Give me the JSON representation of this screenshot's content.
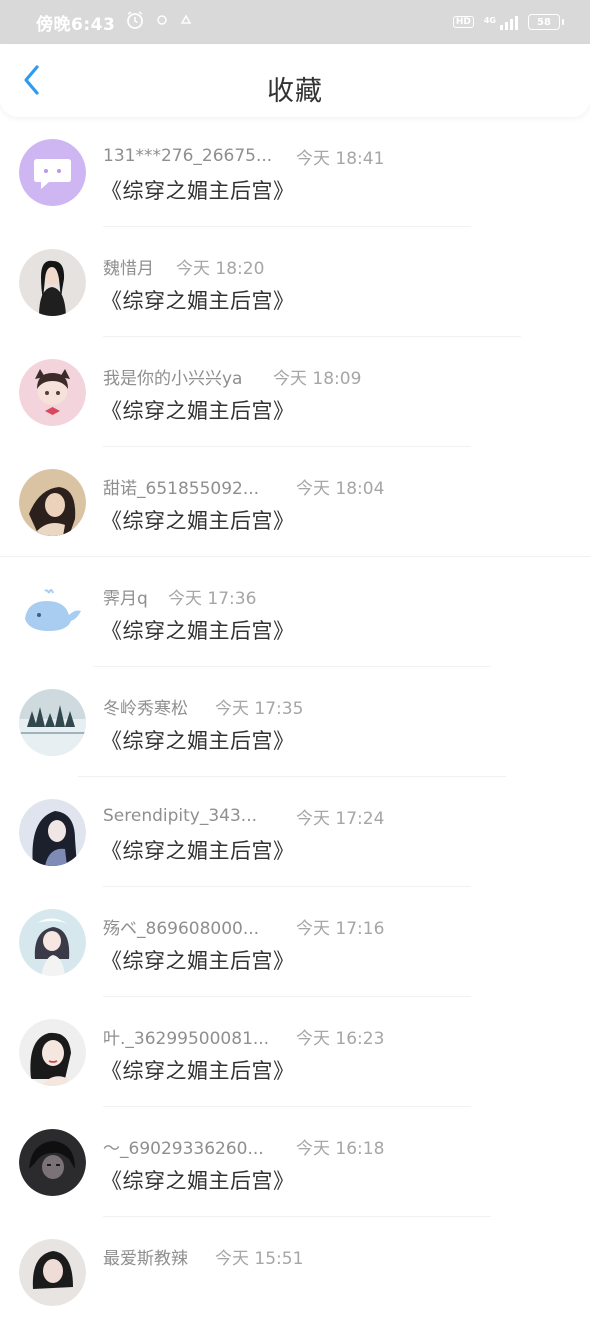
{
  "status_bar": {
    "time": "傍晚6:43",
    "network": "4G",
    "battery": "58"
  },
  "header": {
    "title": "收藏"
  },
  "items": [
    {
      "name": "131***276_26675...",
      "time": "今天 18:41",
      "title": "《综穿之媚主后宫》"
    },
    {
      "name": "魏惜月",
      "time": "今天 18:20",
      "title": "《综穿之媚主后宫》"
    },
    {
      "name": "我是你的小兴兴ya",
      "time": "今天 18:09",
      "title": "《综穿之媚主后宫》"
    },
    {
      "name": "甜诺_651855092...",
      "time": "今天 18:04",
      "title": "《综穿之媚主后宫》"
    },
    {
      "name": "霁月q",
      "time": "今天 17:36",
      "title": "《综穿之媚主后宫》"
    },
    {
      "name": "冬岭秀寒松",
      "time": "今天 17:35",
      "title": "《综穿之媚主后宫》"
    },
    {
      "name": "Serendipity_343...",
      "time": "今天 17:24",
      "title": "《综穿之媚主后宫》"
    },
    {
      "name": "殇ベ_869608000...",
      "time": "今天 17:16",
      "title": "《综穿之媚主后宫》"
    },
    {
      "name": "叶._36299500081...",
      "time": "今天 16:23",
      "title": "《综穿之媚主后宫》"
    },
    {
      "name": "～_69029336260...",
      "time": "今天 16:18",
      "title": "《综穿之媚主后宫》"
    },
    {
      "name": "最爱斯教辣",
      "time": "今天 15:51",
      "title": ""
    }
  ],
  "colors": {
    "accent": "#2f9bf0",
    "text_primary": "#333333",
    "text_secondary": "#8f8f8f",
    "status_bar_bg": "#d9d9d9"
  }
}
